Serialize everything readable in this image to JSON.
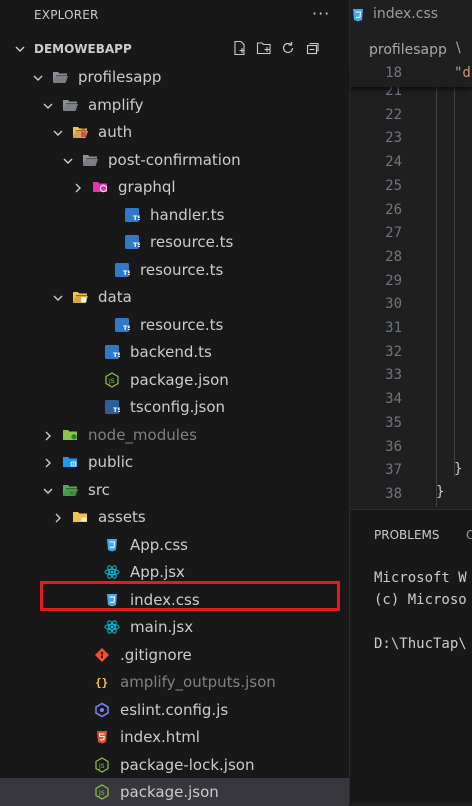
{
  "explorer": {
    "title": "EXPLORER",
    "more": "···",
    "section_label": "DEMOWEBAPP",
    "tree": [
      {
        "label": "profilesapp",
        "depth": 1,
        "type": "folder-open",
        "icon": "folder-open-icon",
        "color": "#8d9199"
      },
      {
        "label": "amplify",
        "depth": 2,
        "type": "folder-open",
        "icon": "folder-open-icon",
        "color": "#8d9199"
      },
      {
        "label": "auth",
        "depth": 3,
        "type": "folder-open",
        "icon": "folder-auth-icon",
        "color": "#f2c14e"
      },
      {
        "label": "post-confirmation",
        "depth": 4,
        "type": "folder-open",
        "icon": "folder-open-icon",
        "color": "#8d9199"
      },
      {
        "label": "graphql",
        "depth": 5,
        "type": "folder-closed",
        "icon": "folder-graphql-icon",
        "color": "#e535ab"
      },
      {
        "label": "handler.ts",
        "depth": 6,
        "type": "file",
        "icon": "typescript-icon"
      },
      {
        "label": "resource.ts",
        "depth": 6,
        "type": "file",
        "icon": "typescript-icon"
      },
      {
        "label": "resource.ts",
        "depth": 5,
        "type": "file",
        "icon": "typescript-icon"
      },
      {
        "label": "data",
        "depth": 3,
        "type": "folder-open",
        "icon": "folder-data-icon",
        "color": "#f2c14e"
      },
      {
        "label": "resource.ts",
        "depth": 5,
        "type": "file",
        "icon": "typescript-icon"
      },
      {
        "label": "backend.ts",
        "depth": 4,
        "type": "file",
        "icon": "typescript-icon"
      },
      {
        "label": "package.json",
        "depth": 4,
        "type": "file",
        "icon": "nodejs-icon"
      },
      {
        "label": "tsconfig.json",
        "depth": 4,
        "type": "file",
        "icon": "tsconfig-icon"
      },
      {
        "label": "node_modules",
        "depth": 2,
        "type": "folder-closed",
        "icon": "folder-node-icon",
        "color": "#8bc34a",
        "dim": true
      },
      {
        "label": "public",
        "depth": 2,
        "type": "folder-closed",
        "icon": "folder-public-icon",
        "color": "#2196f3"
      },
      {
        "label": "src",
        "depth": 2,
        "type": "folder-open",
        "icon": "folder-src-icon",
        "color": "#4caf50"
      },
      {
        "label": "assets",
        "depth": 3,
        "type": "folder-closed",
        "icon": "folder-assets-icon",
        "color": "#f2c14e"
      },
      {
        "label": "App.css",
        "depth": 4,
        "type": "file",
        "icon": "css-icon"
      },
      {
        "label": "App.jsx",
        "depth": 4,
        "type": "file",
        "icon": "react-icon"
      },
      {
        "label": "index.css",
        "depth": 4,
        "type": "file",
        "icon": "css-icon"
      },
      {
        "label": "main.jsx",
        "depth": 4,
        "type": "file",
        "icon": "react-icon"
      },
      {
        "label": ".gitignore",
        "depth": 3,
        "type": "file",
        "icon": "git-icon"
      },
      {
        "label": "amplify_outputs.json",
        "depth": 3,
        "type": "file",
        "icon": "json-icon",
        "dim": true
      },
      {
        "label": "eslint.config.js",
        "depth": 3,
        "type": "file",
        "icon": "eslint-icon"
      },
      {
        "label": "index.html",
        "depth": 3,
        "type": "file",
        "icon": "html-icon"
      },
      {
        "label": "package-lock.json",
        "depth": 3,
        "type": "file",
        "icon": "nodejs-icon"
      },
      {
        "label": "package.json",
        "depth": 3,
        "type": "file",
        "icon": "nodejs-icon",
        "selected": true
      }
    ]
  },
  "tab": {
    "label": "index.css"
  },
  "breadcrumb": {
    "folder": "profilesapp",
    "sep": "\\"
  },
  "editor": {
    "sticky_line": "18",
    "sticky_code": "\"d",
    "lines": [
      "21",
      "22",
      "23",
      "24",
      "25",
      "26",
      "27",
      "28",
      "29",
      "30",
      "31",
      "32",
      "33",
      "34",
      "35",
      "36",
      "37",
      "38"
    ],
    "line37_code": "}",
    "line38_code": "}"
  },
  "panel": {
    "problems_tab": "PROBLEMS",
    "terminal_lines": [
      "Microsoft W",
      "(c) Microso",
      "",
      "D:\\ThucTap\\"
    ]
  },
  "colors": {
    "accent_red": "#e31c23",
    "ts_blue": "#3178c6",
    "css_blue": "#42a5f5",
    "react_cyan": "#00bcd4",
    "git_orange": "#f4511e",
    "json_yellow": "#f5c84c",
    "html_orange": "#e44d26",
    "node_green": "#8bc34a"
  }
}
